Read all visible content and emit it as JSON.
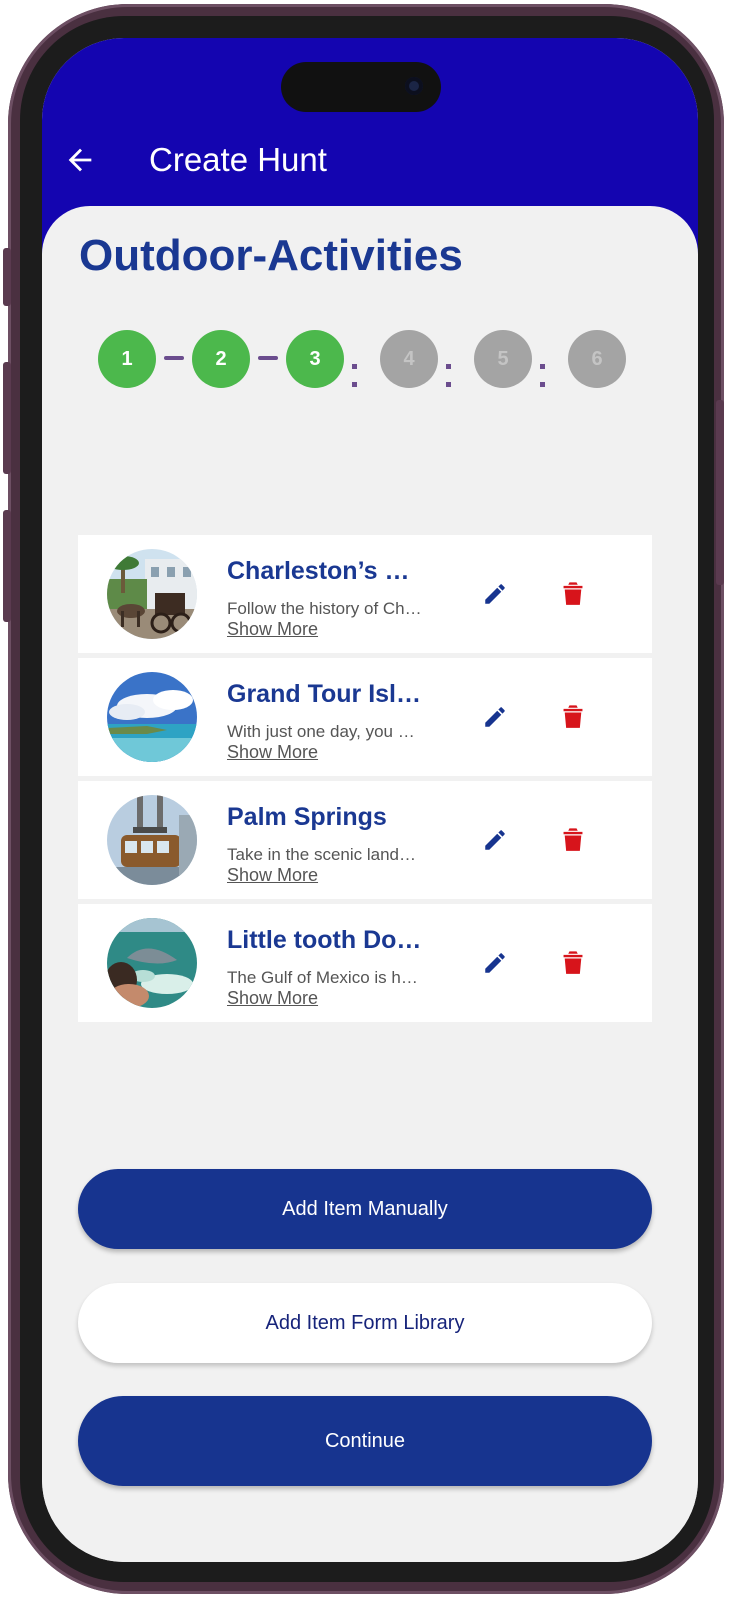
{
  "appbar": {
    "title": "Create Hunt",
    "back_icon": "arrow-left-icon"
  },
  "hunt": {
    "title": "Outdoor-Activities"
  },
  "stepper": {
    "steps": [
      {
        "label": "1",
        "state": "completed"
      },
      {
        "label": "2",
        "state": "completed"
      },
      {
        "label": "3",
        "state": "completed"
      },
      {
        "label": "4",
        "state": "pending"
      },
      {
        "label": "5",
        "state": "pending"
      },
      {
        "label": "6",
        "state": "pending"
      }
    ]
  },
  "items": [
    {
      "title": "Charleston’s Horse Carriage Tour",
      "description": "Follow the history of Charleston",
      "show_more": "Show More",
      "edit_icon": "pencil-icon",
      "delete_icon": "trash-icon"
    },
    {
      "title": "Grand Tour Island",
      "description": "With just one day, you can explore",
      "show_more": "Show More",
      "edit_icon": "pencil-icon",
      "delete_icon": "trash-icon"
    },
    {
      "title": "Palm Springs",
      "description": "Take in the scenic landscape",
      "show_more": "Show More",
      "edit_icon": "pencil-icon",
      "delete_icon": "trash-icon"
    },
    {
      "title": "Little tooth Dolphin",
      "description": "The Gulf of Mexico is home",
      "show_more": "Show More",
      "edit_icon": "pencil-icon",
      "delete_icon": "trash-icon"
    }
  ],
  "actions": {
    "add_manual": "Add Item Manually",
    "add_library": "Add Item Form Library",
    "continue": "Continue"
  },
  "colors": {
    "appbar": "#1405b0",
    "brand_blue": "#17348f",
    "step_done": "#4cb84c",
    "step_pending": "#a4a4a4",
    "delete_red": "#d7141b"
  }
}
